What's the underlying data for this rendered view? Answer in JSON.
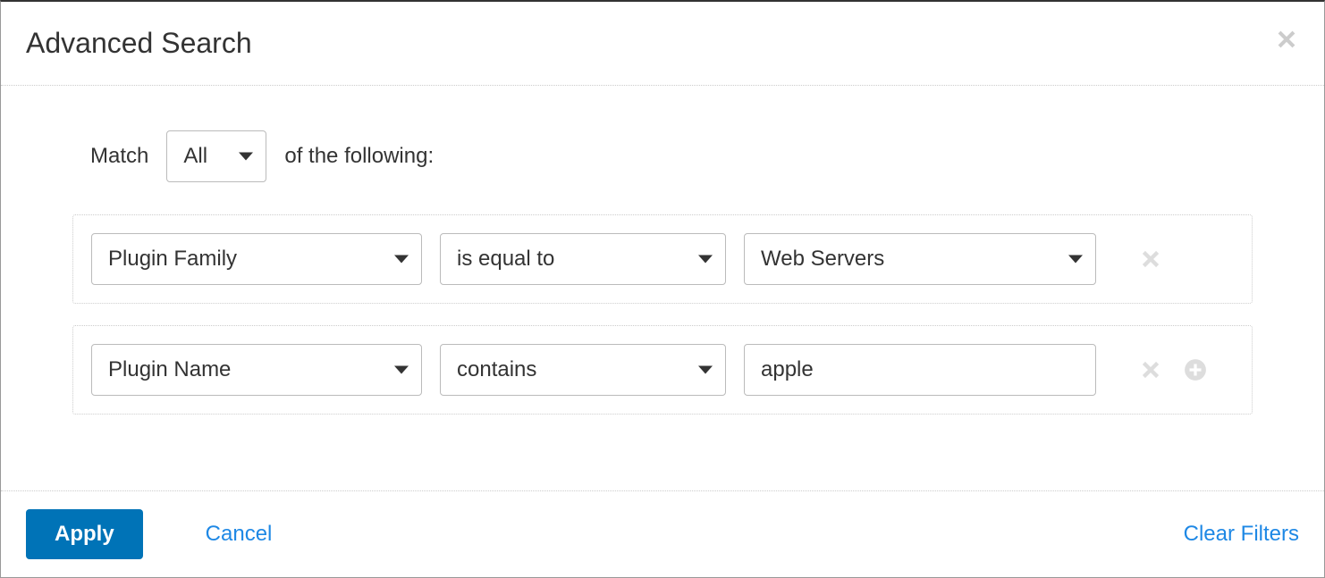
{
  "header": {
    "title": "Advanced Search"
  },
  "match": {
    "prefix": "Match",
    "value": "All",
    "suffix": "of the following:"
  },
  "filters": [
    {
      "field": "Plugin Family",
      "operator": "is equal to",
      "value_type": "select",
      "value": "Web Servers",
      "show_add": false
    },
    {
      "field": "Plugin Name",
      "operator": "contains",
      "value_type": "text",
      "value": "apple",
      "show_add": true
    }
  ],
  "footer": {
    "apply": "Apply",
    "cancel": "Cancel",
    "clear": "Clear Filters"
  }
}
